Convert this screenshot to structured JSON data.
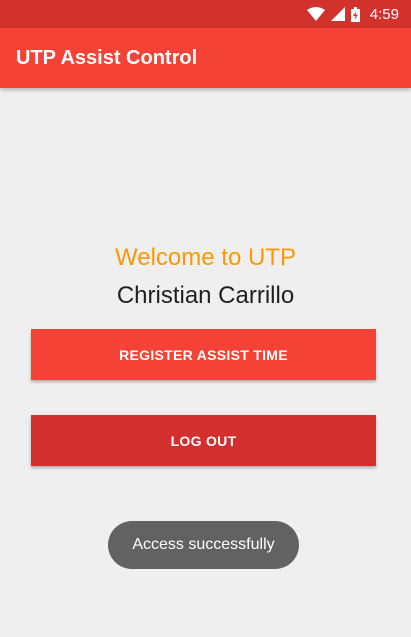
{
  "status_bar": {
    "time": "4:59",
    "icons": [
      "wifi-icon",
      "cell-signal-icon",
      "battery-charging-icon"
    ]
  },
  "app_bar": {
    "title": "UTP Assist Control"
  },
  "main": {
    "welcome_text": "Welcome to UTP",
    "user_name": "Christian Carrillo",
    "register_button_label": "REGISTER ASSIST TIME",
    "logout_button_label": "LOG OUT"
  },
  "toast": {
    "message": "Access successfully"
  },
  "colors": {
    "primary": "#f44336",
    "primary_dark": "#d32f2f",
    "accent": "#ff9800",
    "background": "#efefef"
  }
}
